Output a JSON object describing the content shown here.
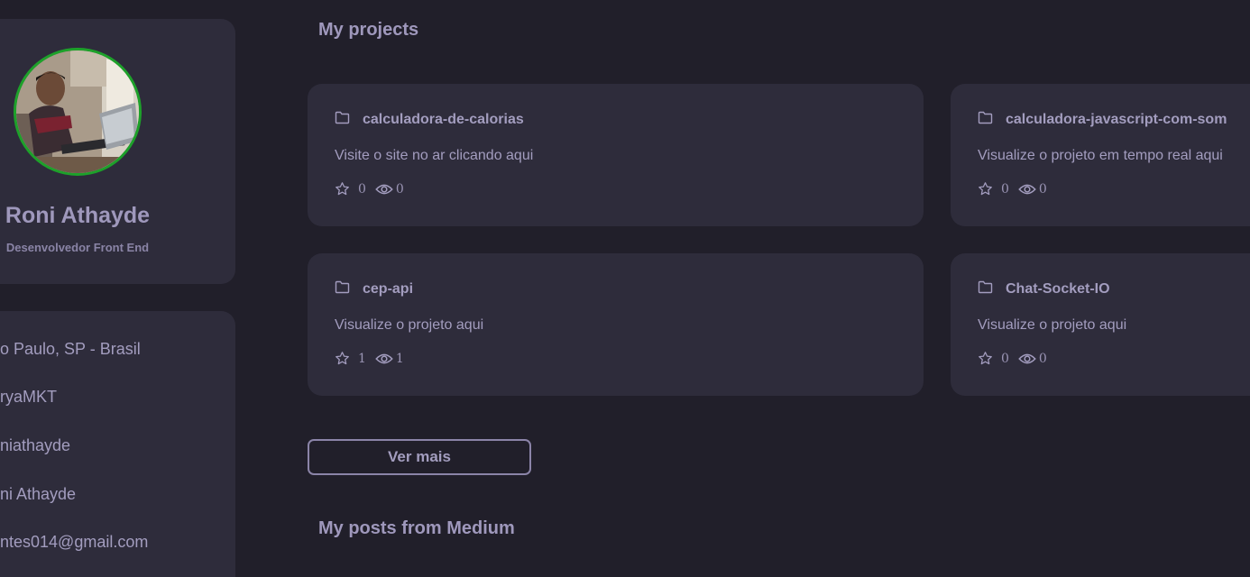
{
  "profile": {
    "name": "Roni Athayde",
    "role": "Desenvolvedor Front End"
  },
  "info": {
    "items": [
      {
        "icon": "map-pin-icon",
        "text": "o Paulo, SP - Brasil"
      },
      {
        "icon": "building-icon",
        "text": "ryaMKT"
      },
      {
        "icon": "github-icon",
        "text": "niathayde"
      },
      {
        "icon": "linkedin-icon",
        "text": "ni Athayde"
      },
      {
        "icon": "mail-icon",
        "text": "ntes014@gmail.com"
      }
    ]
  },
  "projects_section": {
    "title": "My projects"
  },
  "projects": [
    {
      "name": "calculadora-de-calorias",
      "description": "Visite o site no ar clicando aqui",
      "stars": "0",
      "views": "0"
    },
    {
      "name": "calculadora-javascript-com-som",
      "description": "Visualize o projeto em tempo real aqui",
      "stars": "0",
      "views": "0"
    },
    {
      "name": "cep-api",
      "description": "Visualize o projeto aqui",
      "stars": "1",
      "views": "1"
    },
    {
      "name": "Chat-Socket-IO",
      "description": "Visualize o projeto aqui",
      "stars": "0",
      "views": "0"
    }
  ],
  "more_button": {
    "label": "Ver mais"
  },
  "posts_section": {
    "title": "My posts from Medium"
  },
  "colors": {
    "background": "#211f2a",
    "card": "#2e2c3b",
    "text": "#a39dbf",
    "avatar_border": "#1da12a"
  }
}
